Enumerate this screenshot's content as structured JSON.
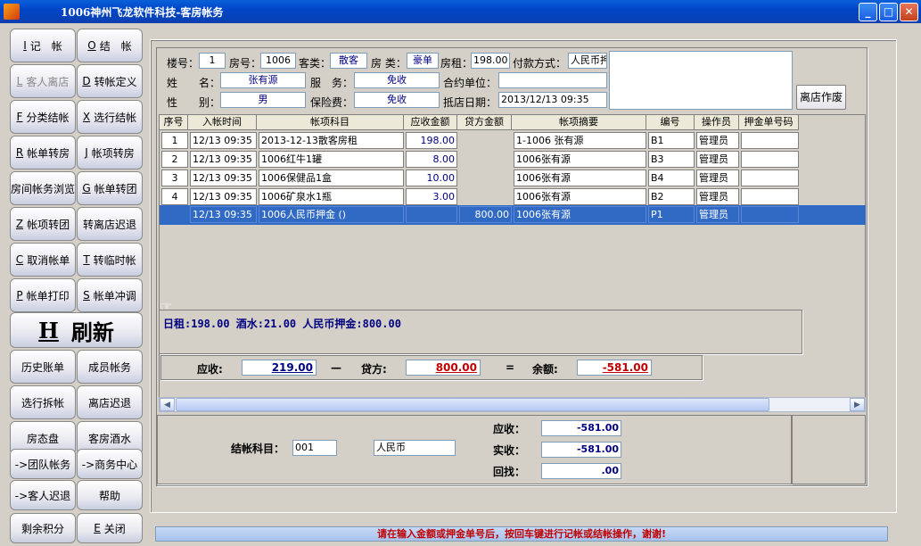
{
  "window": {
    "title": "1006神州飞龙软件科技-客房帐务"
  },
  "sidebar": {
    "buttons": [
      {
        "key": "I",
        "label": "记　帐"
      },
      {
        "key": "O",
        "label": "结　帐"
      },
      {
        "key": "L",
        "label": "客人离店"
      },
      {
        "key": "D",
        "label": "转帐定义"
      },
      {
        "key": "F",
        "label": "分类结帐"
      },
      {
        "key": "X",
        "label": "选行结帐"
      },
      {
        "key": "R",
        "label": "帐单转房"
      },
      {
        "key": "J",
        "label": "帐项转房"
      },
      {
        "key": "",
        "label": "房间帐务浏览"
      },
      {
        "key": "G",
        "label": "帐单转团"
      },
      {
        "key": "Z",
        "label": "帐项转团"
      },
      {
        "key": "",
        "label": "转离店迟退"
      },
      {
        "key": "C",
        "label": "取消帐单"
      },
      {
        "key": "T",
        "label": "转临时帐"
      },
      {
        "key": "P",
        "label": "帐单打印"
      },
      {
        "key": "S",
        "label": "帐单冲调"
      }
    ],
    "refresh": {
      "key": "H",
      "label": "刷新"
    },
    "buttons2": [
      {
        "key": "",
        "label": "历史账单"
      },
      {
        "key": "",
        "label": "成员帐务"
      },
      {
        "key": "",
        "label": "选行拆帐"
      },
      {
        "key": "",
        "label": "离店迟退"
      },
      {
        "key": "",
        "label": "房态盘"
      },
      {
        "key": "",
        "label": "客房酒水"
      },
      {
        "key": "",
        "label": "->团队帐务"
      },
      {
        "key": "",
        "label": "->商务中心"
      },
      {
        "key": "",
        "label": "->客人迟退"
      },
      {
        "key": "",
        "label": "帮助"
      },
      {
        "key": "",
        "label": "剩余积分"
      },
      {
        "key": "E",
        "label": "关闭"
      }
    ]
  },
  "header": {
    "building_label": "楼号：",
    "building": "1",
    "room_label": "房号：",
    "room": "1006",
    "guest_type_label": "客类：",
    "guest_type": "散客",
    "room_type_label": "房 类：",
    "room_type": "豪单",
    "rent_label": "房租：",
    "rent": "198.00",
    "pay_method_label": "付款方式：",
    "pay_method": "人民币押",
    "name_label": "姓　　名：",
    "name": "张有源",
    "service_label": "服　务：",
    "service": "免收",
    "contract_label": "合约单位：",
    "contract": "",
    "gender_label": "性　　别：",
    "gender": "男",
    "insurance_label": "保险费：",
    "insurance": "免收",
    "arrival_label": "抵店日期：",
    "arrival": "2013/12/13 09:35",
    "checkout_btn": "离店作废"
  },
  "grid": {
    "columns": [
      "序号",
      "入帐时间",
      "帐项科目",
      "应收金额",
      "贷方金额",
      "帐项摘要",
      "编号",
      "操作员",
      "押金单号码"
    ],
    "rows": [
      {
        "no": "1",
        "time": "12/13 09:35",
        "item": "2013-12-13散客房租",
        "debit": "198.00",
        "credit": "",
        "summary": "1-1006 张有源",
        "code": "B1",
        "operator": "管理员",
        "deposit": ""
      },
      {
        "no": "2",
        "time": "12/13 09:35",
        "item": "1006红牛1罐",
        "debit": "8.00",
        "credit": "",
        "summary": "1006张有源",
        "code": "B3",
        "operator": "管理员",
        "deposit": ""
      },
      {
        "no": "3",
        "time": "12/13 09:35",
        "item": "1006保健品1盒",
        "debit": "10.00",
        "credit": "",
        "summary": "1006张有源",
        "code": "B4",
        "operator": "管理员",
        "deposit": ""
      },
      {
        "no": "4",
        "time": "12/13 09:35",
        "item": "1006矿泉水1瓶",
        "debit": "3.00",
        "credit": "",
        "summary": "1006张有源",
        "code": "B2",
        "operator": "管理员",
        "deposit": ""
      }
    ],
    "selected": {
      "no": "",
      "time": "12/13 09:35",
      "item": "1006人民币押金 ()",
      "debit": "",
      "credit": "800.00",
      "summary": "1006张有源",
      "code": "P1",
      "operator": "管理员",
      "deposit": ""
    }
  },
  "summary": {
    "text": "日租:198.00 酒水:21.00 人民币押金:800.00"
  },
  "totals": {
    "receivable_label": "应收:",
    "receivable": "219.00",
    "minus": "—",
    "credit_label": "贷方:",
    "credit": "800.00",
    "equals": "=",
    "balance_label": "余额:",
    "balance": "-581.00"
  },
  "payment": {
    "subject_label": "结帐科目：",
    "subject_code": "001",
    "subject_name": "人民币",
    "due_label": "应收：",
    "due": "-581.00",
    "paid_label": "实收：",
    "paid": "-581.00",
    "change_label": "回找：",
    "change": ".00"
  },
  "status": {
    "message": "请在输入金额或押金单号后，按回车键进行记帐或结帐操作，谢谢!"
  },
  "colors": {
    "title_bar": "#0a5fd8",
    "selection": "#316ac5",
    "negative": "#c00000",
    "amount": "#000080"
  }
}
